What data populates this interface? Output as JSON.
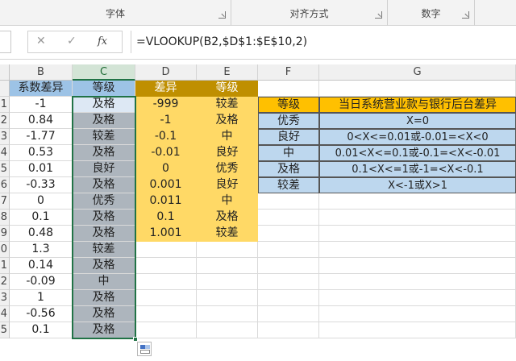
{
  "ribbon": {
    "groups": [
      {
        "label": "字体"
      },
      {
        "label": "对齐方式"
      },
      {
        "label": "数字"
      }
    ]
  },
  "formula_bar": {
    "cancel_icon": "✕",
    "enter_icon": "✓",
    "fx_label": "fx",
    "formula": "=VLOOKUP(B2,$D$1:$E$10,2)"
  },
  "columns": [
    "B",
    "C",
    "D",
    "E",
    "F",
    "G"
  ],
  "rows": [
    {
      "n": "",
      "b": "系数差异",
      "c": "等级",
      "d": "差异",
      "e": "等级",
      "f": "",
      "g": ""
    },
    {
      "n": "1",
      "b": "-1",
      "c": "及格",
      "d": "-999",
      "e": "较差",
      "f": "等级",
      "g": "当日系统营业款与银行后台差异"
    },
    {
      "n": "2",
      "b": "0.84",
      "c": "及格",
      "d": "-1",
      "e": "及格",
      "f": "优秀",
      "g": "X=0"
    },
    {
      "n": "3",
      "b": "-1.77",
      "c": "较差",
      "d": "-0.1",
      "e": "中",
      "f": "良好",
      "g": "0<X<=0.01或-0.01=<X<0"
    },
    {
      "n": "4",
      "b": "0.53",
      "c": "及格",
      "d": "-0.01",
      "e": "良好",
      "f": "中",
      "g": "0.01<X<=0.1或-0.1=<X<-0.01"
    },
    {
      "n": "5",
      "b": "0.01",
      "c": "良好",
      "d": "0",
      "e": "优秀",
      "f": "及格",
      "g": "0.1<X<=1或-1=<X<-0.1"
    },
    {
      "n": "6",
      "b": "-0.33",
      "c": "及格",
      "d": "0.001",
      "e": "良好",
      "f": "较差",
      "g": "X<-1或X>1"
    },
    {
      "n": "7",
      "b": "0",
      "c": "优秀",
      "d": "0.011",
      "e": "中",
      "f": "",
      "g": ""
    },
    {
      "n": "8",
      "b": "0.1",
      "c": "及格",
      "d": "0.1",
      "e": "及格",
      "f": "",
      "g": ""
    },
    {
      "n": "9",
      "b": "0.48",
      "c": "及格",
      "d": "1.001",
      "e": "较差",
      "f": "",
      "g": ""
    },
    {
      "n": "0",
      "b": "1.3",
      "c": "较差",
      "d": "",
      "e": "",
      "f": "",
      "g": ""
    },
    {
      "n": "1",
      "b": "0.14",
      "c": "及格",
      "d": "",
      "e": "",
      "f": "",
      "g": ""
    },
    {
      "n": "2",
      "b": "-0.09",
      "c": "中",
      "d": "",
      "e": "",
      "f": "",
      "g": ""
    },
    {
      "n": "3",
      "b": "1",
      "c": "及格",
      "d": "",
      "e": "",
      "f": "",
      "g": ""
    },
    {
      "n": "4",
      "b": "-0.56",
      "c": "及格",
      "d": "",
      "e": "",
      "f": "",
      "g": ""
    },
    {
      "n": "5",
      "b": "0.1",
      "c": "及格",
      "d": "",
      "e": "",
      "f": "",
      "g": ""
    }
  ],
  "colors": {
    "selection": "#217346",
    "grade_fill": "#adb5bd",
    "lookup_fill": "#ffd966",
    "lookup_header": "#bf8f00",
    "table_header": "#ffc000",
    "table_fill": "#bdd7ee"
  }
}
